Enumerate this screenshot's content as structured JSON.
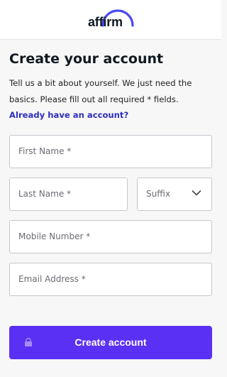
{
  "header": {
    "logo_text": "affirm"
  },
  "form": {
    "title": "Create your account",
    "intro_text": "Tell us a bit about yourself. We just need the basics. Please fill out all required * fields.",
    "login_link": "Already have an account?",
    "fields": {
      "first_name": {
        "placeholder": "First Name *",
        "value": ""
      },
      "last_name": {
        "placeholder": "Last Name *",
        "value": ""
      },
      "suffix": {
        "selected": "Suffix"
      },
      "mobile": {
        "placeholder": "Mobile Number *",
        "value": ""
      },
      "email": {
        "placeholder": "Email Address *",
        "value": ""
      }
    },
    "submit_label": "Create account"
  },
  "icons": {
    "suffix_dropdown": "chevron-down-icon",
    "submit_lock": "lock-icon"
  },
  "colors": {
    "brand": "#5a31f4",
    "link": "#2d2dbf",
    "text": "#101820"
  }
}
